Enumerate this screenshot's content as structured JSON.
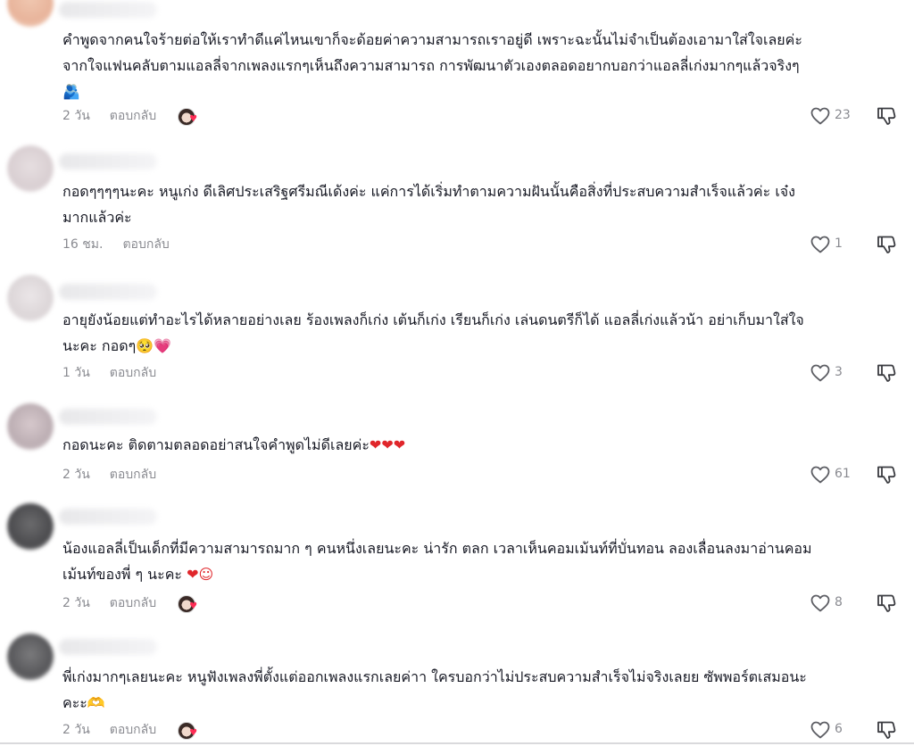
{
  "reply_label": "ตอบกลับ",
  "comments": [
    {
      "text_line1": "คำพูดจากคนใจร้ายต่อให้เราทำดีแค่ไหนเขาก็จะด้อยค่าความสามารถเราอยู่ดี เพราะฉะนั้นไม่จำเป็นต้องเอามาใส่ใจเลยค่ะ",
      "text_line2": "จากใจแฟนคลับตามแอลลี่จากเพลงแรกๆเห็นถึงความสามารถ การพัฒนาตัวเองตลอดอยากบอกว่าแอลลี่เก่งมากๆแล้วจริงๆ",
      "emoji": "🫂",
      "time": "2 วัน",
      "likes": "23",
      "creator_liked": true
    },
    {
      "text_line1": "กอดๆๆๆๆนะคะ หนูเก่ง ดีเลิศประเสริฐศรีมณีเด้งค่ะ แค่การได้เริ่มทำตามความฝันนั้นคือสิ่งที่ประสบความสำเร็จแล้วค่ะ เจ๋ง",
      "text_line2": "มากแล้วค่ะ",
      "time": "16 ชม.",
      "likes": "1",
      "creator_liked": false
    },
    {
      "text_line1": "อายุยังน้อยแต่ทำอะไรได้หลายอย่างเลย ร้องเพลงก็เก่ง เต้นก็เก่ง เรียนก็เก่ง เล่นดนตรีก็ได้ แอลลี่เก่งแล้วน้า อย่าเก็บมาใส่ใจ",
      "text_line2": "นะคะ กอดๆ",
      "emoji": "🥺💗",
      "time": "1 วัน",
      "likes": "3",
      "creator_liked": false
    },
    {
      "text_line1": "กอดนะคะ ติดตามตลอดอย่าสนใจคำพูดไม่ดีเลยค่ะ",
      "emoji": "❤❤❤",
      "time": "2 วัน",
      "likes": "61",
      "creator_liked": false
    },
    {
      "text_line1": "น้องแอลลี่เป็นเด็กที่มีความสามารถมาก ๆ คนหนึ่งเลยนะคะ น่ารัก ตลก เวลาเห็นคอมเม้นท์ที่บั่นทอน ลองเลื่อนลงมาอ่านคอม",
      "text_line2": "เม้นท์ของพี่ ๆ นะคะ",
      "emoji": "❤☺",
      "time": "2 วัน",
      "likes": "8",
      "creator_liked": true
    },
    {
      "text_line1": "พี่เก่งมากๆเลยนะคะ หนูฟังเพลงพี่ตั้งแต่ออกเพลงแรกเลยค่าา ใครบอกว่าไม่ประสบความสำเร็จไม่จริงเลยย ซัพพอร์ตเสมอนะ",
      "text_line2": "คะะ",
      "emoji": "🫶",
      "time": "2 วัน",
      "likes": "6",
      "creator_liked": true
    }
  ],
  "colors": {
    "text": "#161823",
    "meta": "#8a8b91",
    "accent": "#fe2c55"
  }
}
